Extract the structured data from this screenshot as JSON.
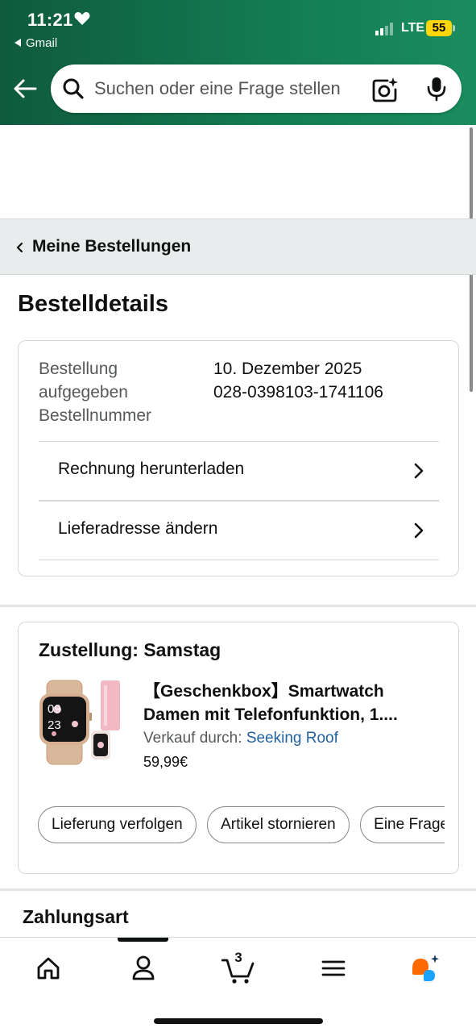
{
  "status_bar": {
    "time": "11:21",
    "back_app": "Gmail",
    "network": "LTE",
    "battery": "55"
  },
  "search": {
    "placeholder": "Suchen oder eine Frage stellen"
  },
  "breadcrumb": {
    "label": "Meine Bestellungen"
  },
  "page": {
    "title": "Bestelldetails"
  },
  "order_info": {
    "label_line1": "Bestellung",
    "label_line2": "aufgegeben",
    "label_line3": "Bestellnummer",
    "date": "10. Dezember 2025",
    "order_number": "028-0398103-1741106"
  },
  "order_actions": [
    {
      "label": "Rechnung herunterladen"
    },
    {
      "label": "Lieferadresse ändern"
    }
  ],
  "delivery": {
    "heading": "Zustellung: Samstag",
    "product_title_line1": "【Geschenkbox】Smartwatch",
    "product_title_line2": "Damen mit Telefonfunktion, 1....",
    "seller_prefix": "Verkauf durch:",
    "seller_name": "Seeking Roof",
    "price": "59,99€",
    "watch_time_hour": "09",
    "watch_time_min": "23",
    "actions": [
      {
        "label": "Lieferung verfolgen"
      },
      {
        "label": "Artikel stornieren"
      },
      {
        "label": "Eine Frage zum Produkt stellen"
      }
    ]
  },
  "payment": {
    "title": "Zahlungsart"
  },
  "bottom_nav": {
    "cart_count": "3",
    "items": [
      "home-icon",
      "account-icon",
      "cart-icon",
      "menu-icon",
      "rufus-icon"
    ]
  },
  "colors": {
    "header_green": "#137a51",
    "link_blue": "#2162a1",
    "battery_yellow": "#ffd60a",
    "assistant_orange": "#ff6a00",
    "assistant_blue": "#1aa3ff"
  }
}
